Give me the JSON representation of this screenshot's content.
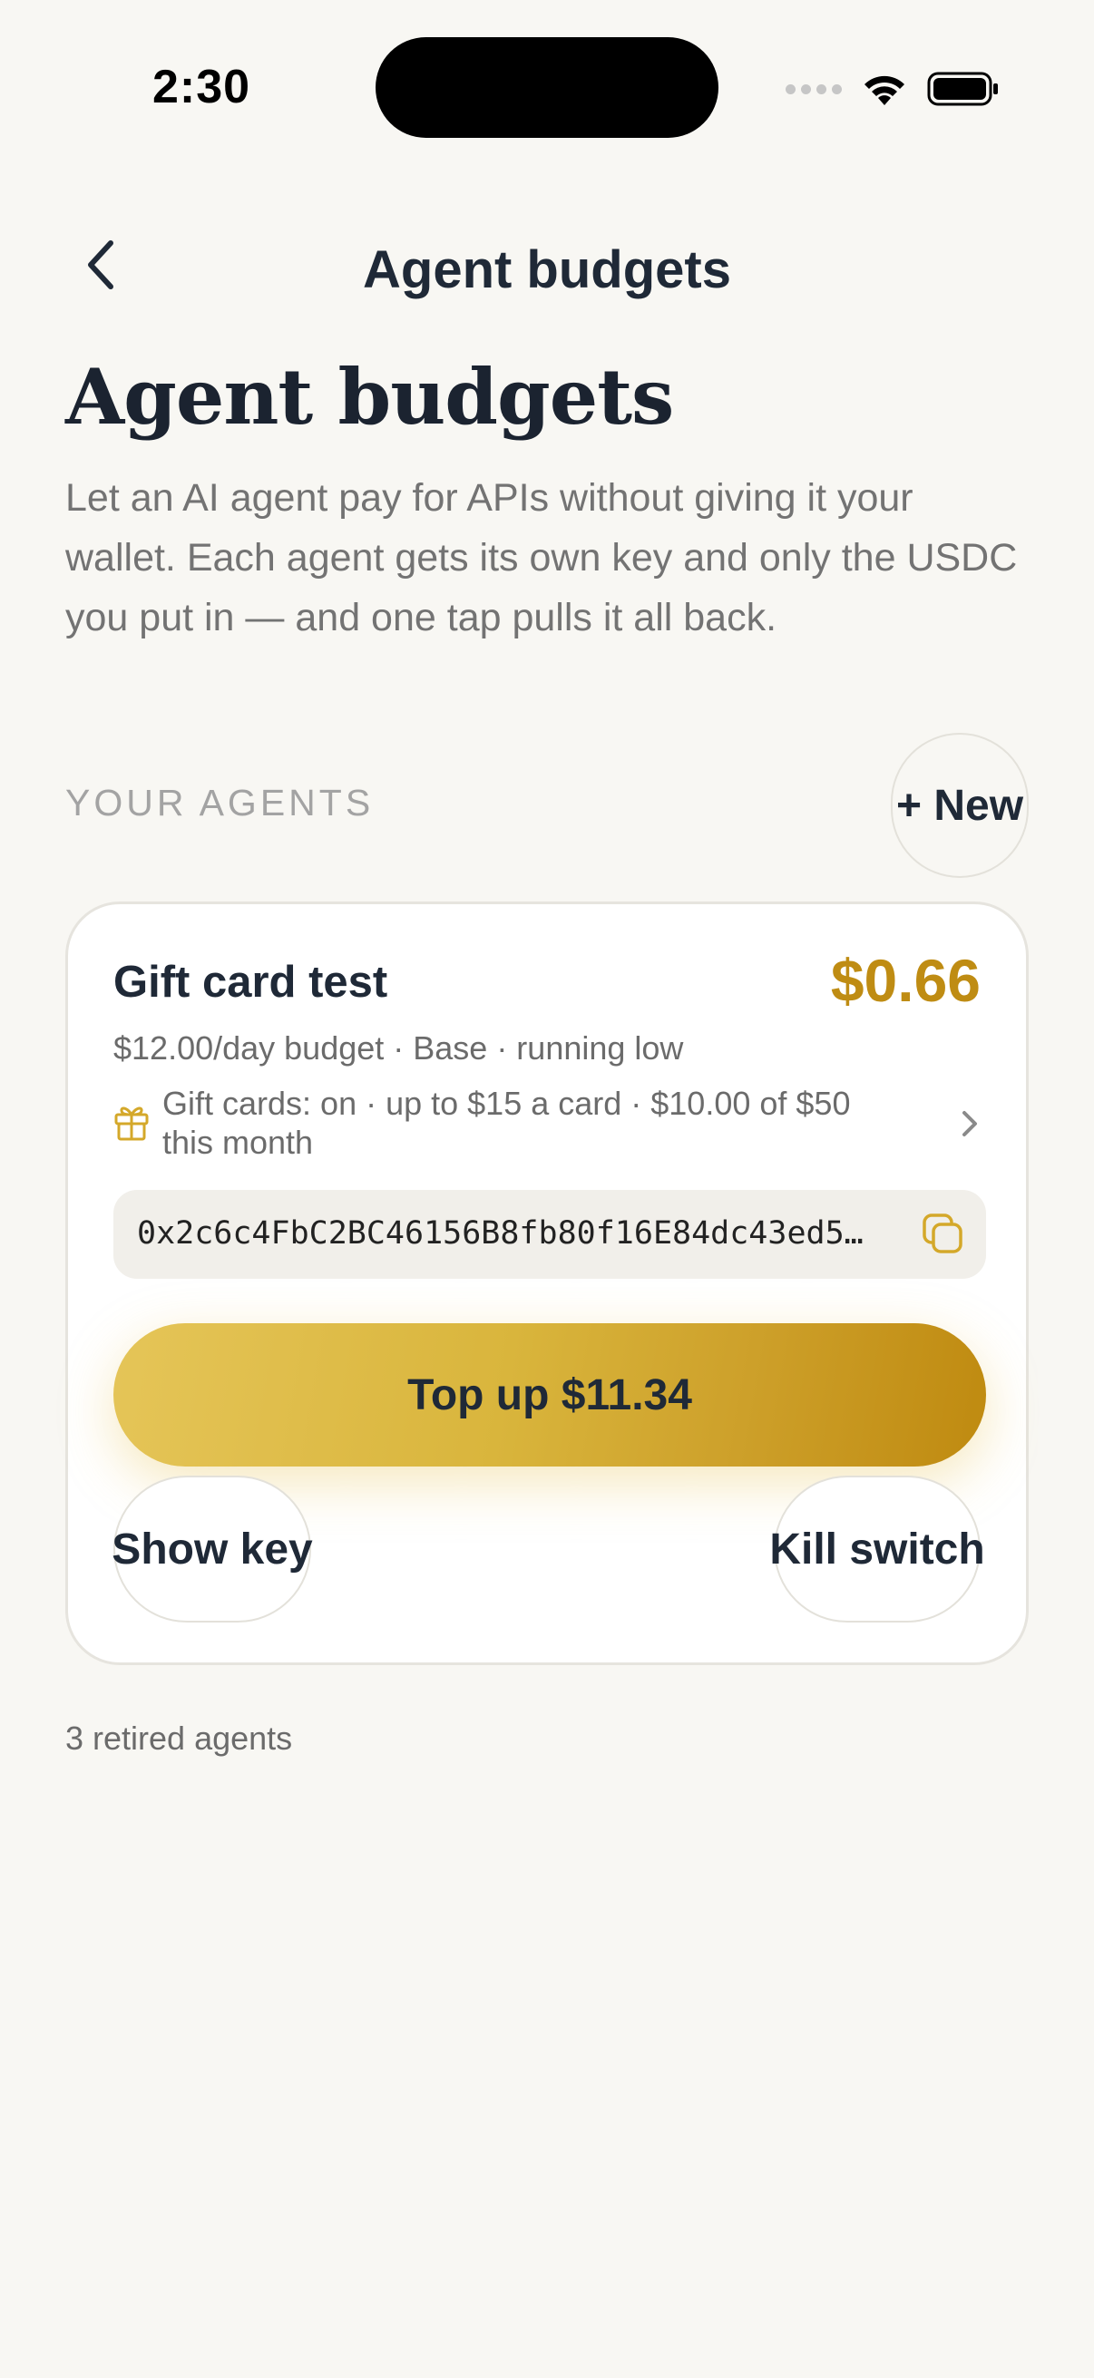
{
  "status_bar": {
    "time": "2:30"
  },
  "nav": {
    "title": "Agent budgets",
    "back_icon": "chevron-left-icon"
  },
  "hero": {
    "title": "Agent budgets",
    "description": "Let an AI agent pay for APIs without giving it your wallet. Each agent gets its own key and only the USDC you put in — and one tap pulls it all back."
  },
  "agents_section": {
    "label": "YOUR AGENTS",
    "new_button_label": "+ New"
  },
  "agents": [
    {
      "name": "Gift card test",
      "balance": "$0.66",
      "meta": "$12.00/day budget · Base · running low",
      "gift_cards": "Gift cards: on · up to $15 a card · $10.00 of $50 this month",
      "key": "0x2c6c4FbC2BC46156B8fb80f16E84dc43ed5…",
      "topup_label": "Top up $11.34",
      "show_key_label": "Show key",
      "kill_switch_label": "Kill switch"
    }
  ],
  "retired": {
    "label": "3 retired agents"
  },
  "colors": {
    "background": "#f8f7f3",
    "accent_gold": "#bf8c13",
    "text_dark": "#1f2937",
    "text_muted": "#6b6b6b"
  }
}
